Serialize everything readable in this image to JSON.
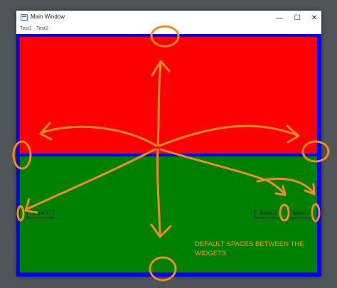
{
  "window": {
    "title": "Main Window",
    "minimize_glyph": "—",
    "maximize_glyph": "☐",
    "close_glyph": "✕"
  },
  "menu": {
    "items": [
      {
        "label": "Test1"
      },
      {
        "label": "Test2"
      }
    ]
  },
  "panels": {
    "top_color": "#ff0000",
    "bottom_color": "#008000",
    "border_color": "#0000ff"
  },
  "buttons": [
    {
      "label": "Button 1"
    },
    {
      "label": "Button 2"
    },
    {
      "label": "Button 3"
    }
  ],
  "annotation": {
    "text": "DEFAULT SPACES BETWEEN THE WIDGETS",
    "color": "#ff9800"
  }
}
